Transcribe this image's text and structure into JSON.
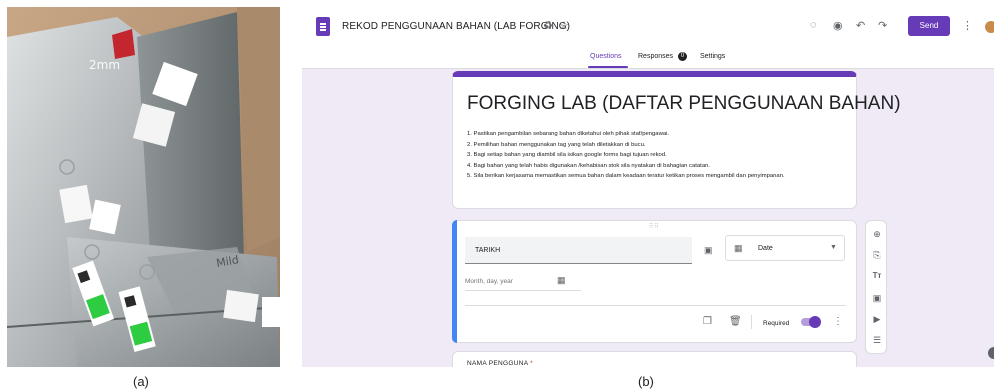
{
  "captions": {
    "left": "(a)",
    "right": "(b)"
  },
  "colors": {
    "accent": "#673ab7",
    "question_accent": "#4285f4",
    "background": "#efeaf6"
  },
  "photo": {
    "annotations": [
      "2mm",
      "Mild"
    ]
  },
  "header": {
    "doc_title": "REKOD PENGGUNAAN BAHAN (LAB FORGING)",
    "icons": [
      "forms-logo-icon",
      "move-to-folder-icon",
      "star-icon",
      "palette-icon",
      "preview-eye-icon",
      "undo-icon",
      "redo-icon",
      "more-vert-icon"
    ],
    "send_label": "Send"
  },
  "tabs": [
    {
      "label": "Questions",
      "active": true
    },
    {
      "label": "Responses",
      "badge": "0"
    },
    {
      "label": "Settings"
    }
  ],
  "form": {
    "title": "FORGING LAB (DAFTAR PENGGUNAAN BAHAN)",
    "instructions": [
      "1. Pastikan pengambilan sebarang bahan diketahui oleh pihak staf/pengawai.",
      "2. Pemilihan bahan menggunakan tag yang telah diletakkan di bucu.",
      "3. Bagi setiap bahan yang diambil sila isikan google forms bagi tujuan rekod.",
      "4. Bagi bahan yang telah habis digunakan /kehabisan stok sila nyatakan di bahagian catatan.",
      "5. Sila berikan kerjasama memastikan semua bahan dalam keadaan teratur ketikan proses mengambil dan penyimpanan."
    ]
  },
  "question": {
    "title": "TARIKH",
    "type": "Date",
    "placeholder": "Month, day, year",
    "required_label": "Required",
    "required": true
  },
  "next_question": {
    "title": "NAMA PENGGUNA",
    "required_mark": "*"
  },
  "side_toolbar": [
    "add-question-icon",
    "import-questions-icon",
    "add-title-icon",
    "add-image-icon",
    "add-video-icon",
    "add-section-icon"
  ]
}
